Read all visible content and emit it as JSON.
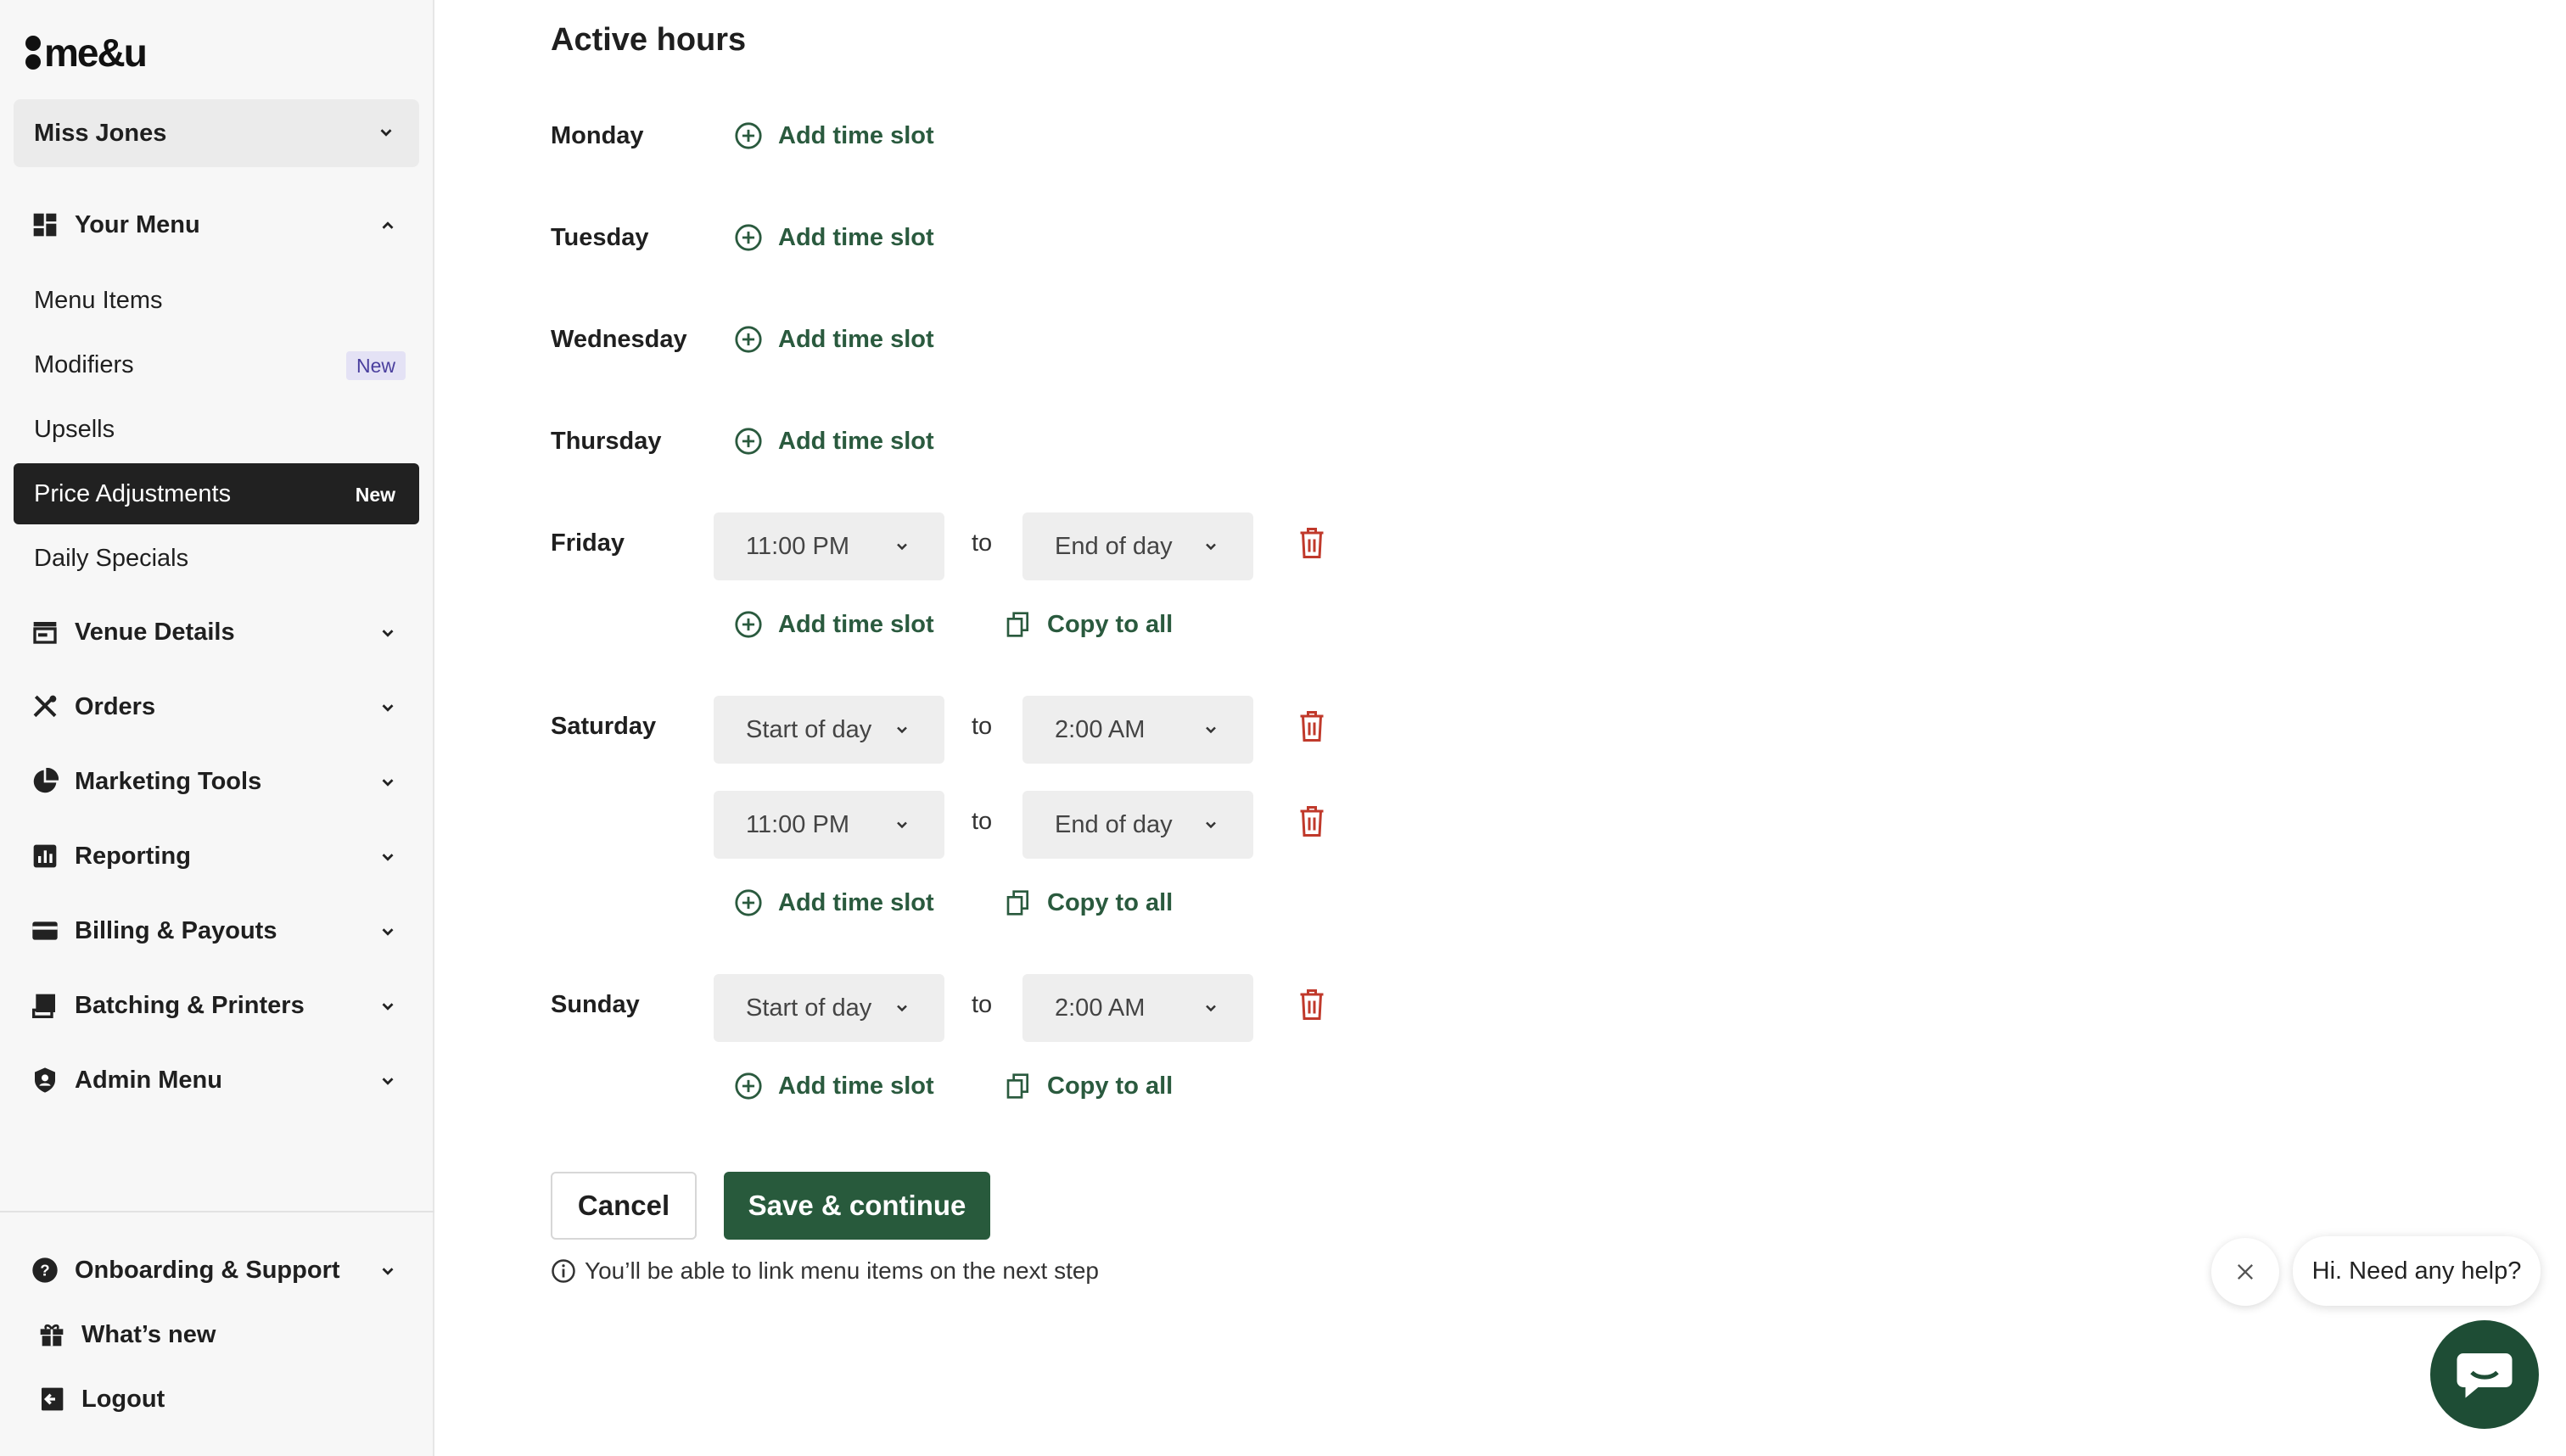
{
  "app": {
    "logo_text": "me&u"
  },
  "sidebar": {
    "venue": "Miss Jones",
    "sections": {
      "your_menu": "Your Menu",
      "venue_details": "Venue Details",
      "orders": "Orders",
      "marketing_tools": "Marketing Tools",
      "reporting": "Reporting",
      "billing_payouts": "Billing & Payouts",
      "batching_printers": "Batching & Printers",
      "admin_menu": "Admin Menu",
      "onboarding_support": "Onboarding & Support"
    },
    "menu_items": [
      {
        "label": "Menu Items",
        "badge": ""
      },
      {
        "label": "Modifiers",
        "badge": "New"
      },
      {
        "label": "Upsells",
        "badge": ""
      },
      {
        "label": "Price Adjustments",
        "badge": "New"
      },
      {
        "label": "Daily Specials",
        "badge": ""
      }
    ],
    "footer": {
      "whats_new": "What’s new",
      "logout": "Logout"
    }
  },
  "main": {
    "title": "Active hours",
    "add_slot_label": "Add time slot",
    "copy_label": "Copy to all",
    "to_label": "to",
    "days": {
      "monday": "Monday",
      "tuesday": "Tuesday",
      "wednesday": "Wednesday",
      "thursday": "Thursday",
      "friday": "Friday",
      "saturday": "Saturday",
      "sunday": "Sunday"
    },
    "slots": {
      "friday_1": {
        "from": "11:00 PM",
        "to": "End of day"
      },
      "saturday_1": {
        "from": "Start of day",
        "to": "2:00 AM"
      },
      "saturday_2": {
        "from": "11:00 PM",
        "to": "End of day"
      },
      "sunday_1": {
        "from": "Start of day",
        "to": "2:00 AM"
      }
    },
    "cancel_label": "Cancel",
    "save_label": "Save & continue",
    "info_text": "You’ll be able to link menu items on the next step"
  },
  "chat": {
    "greeting": "Hi. Need any help?"
  },
  "colors": {
    "accent": "#285a3c",
    "danger": "#c0392b",
    "active_nav": "#212121"
  }
}
